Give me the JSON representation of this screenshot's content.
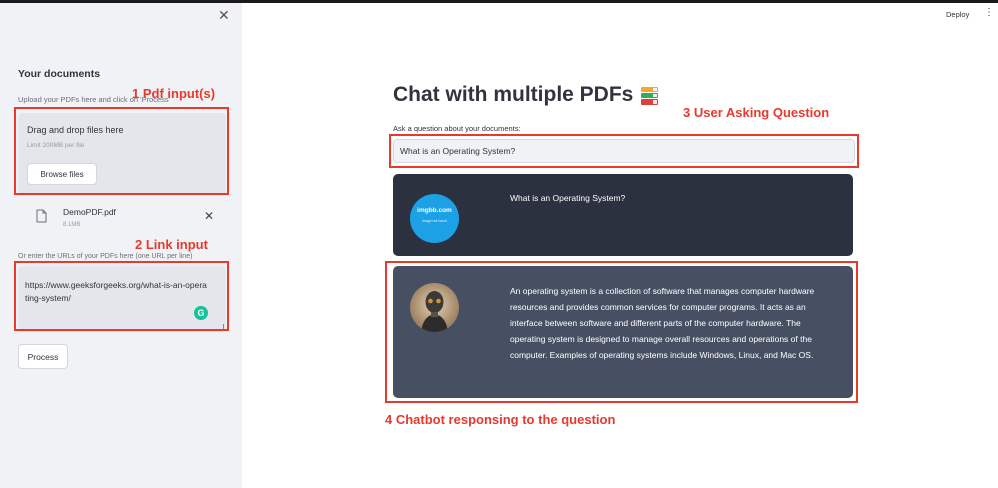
{
  "sidebar": {
    "close_icon": "close-icon",
    "title": "Your documents",
    "upload_help": "Upload your PDFs here and click on 'Process'",
    "dropzone": {
      "title": "Drag and drop files here",
      "limit": "Limit 200MB per file",
      "browse_label": "Browse files"
    },
    "file": {
      "name": "DemoPDF.pdf",
      "size": "8.1MB"
    },
    "url_help": "Or enter the URLs of your PDFs here (one URL per line)",
    "url_value": "https://www.geeksforgeeks.org/what-is-an-operating-system/",
    "process_label": "Process"
  },
  "header": {
    "deploy_label": "Deploy",
    "menu_icon": "⋮"
  },
  "main": {
    "title": "Chat with multiple PDFs",
    "question_label": "Ask a question about your documents:",
    "question_value": "What is an Operating System?",
    "messages": [
      {
        "role": "user",
        "avatar_line1": "imgbb.com",
        "avatar_line2": "Image not found",
        "text": "What is an Operating System?"
      },
      {
        "role": "bot",
        "text": "An operating system is a collection of software that manages computer hardware resources and provides common services for computer programs. It acts as an interface between software and different parts of the computer hardware. The operating system is designed to manage overall resources and operations of the computer. Examples of operating systems include Windows, Linux, and Mac OS."
      }
    ]
  },
  "annotations": {
    "pdf": "1 Pdf input(s)",
    "link": "2 Link input",
    "question": "3 User Asking Question",
    "chatbot": "4 Chatbot  responsing to the question"
  },
  "colors": {
    "annotation": "#e8392d",
    "user_bubble": "#2b313e",
    "bot_bubble": "#475063",
    "sidebar_bg": "#f0f2f6"
  }
}
